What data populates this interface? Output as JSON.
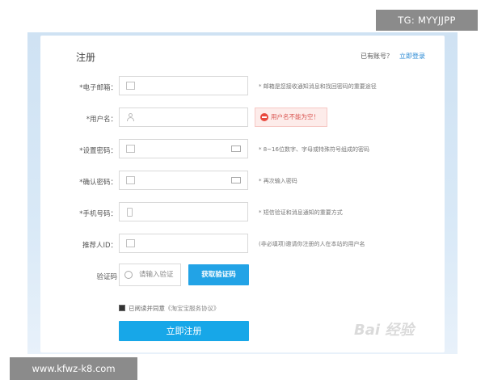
{
  "header": {
    "title": "注册",
    "has_account": "已有账号？",
    "login_link": "立即登录"
  },
  "fields": [
    {
      "label": "*电子邮箱：",
      "hint": "* 邮箱是您接收通知消息和找回密码的重要途径",
      "icon": "mail-icon"
    },
    {
      "label": "*用户名：",
      "error": "用户名不能为空！",
      "icon": "user-icon"
    },
    {
      "label": "*设置密码：",
      "hint": "* 8~16位数字、字母或特殊符号组成的密码",
      "icon": "lock-icon"
    },
    {
      "label": "*确认密码：",
      "hint": "* 再次输入密码",
      "icon": "lock-icon"
    },
    {
      "label": "*手机号码：",
      "hint": "* 短信验证和消息通知的重要方式",
      "icon": "phone-icon"
    },
    {
      "label": "推荐人ID：",
      "hint": "(非必填项)邀请你注册的人在本站的用户名",
      "icon": "id-card-icon"
    }
  ],
  "captcha": {
    "label": "验证码",
    "placeholder": "请输入验证",
    "button": "获取验证码"
  },
  "agreement": {
    "text": "已阅读并同意",
    "link": "《淘宝宝服务协议》"
  },
  "register_button": "立即注册",
  "watermarks": {
    "tg": "TG: MYYJJPP",
    "url": "www.kfwz-k8.com",
    "baidu": "Bai 经验"
  },
  "colors": {
    "accent": "#17a7e8",
    "error_bg": "#fdecea",
    "error_text": "#d9534f"
  }
}
